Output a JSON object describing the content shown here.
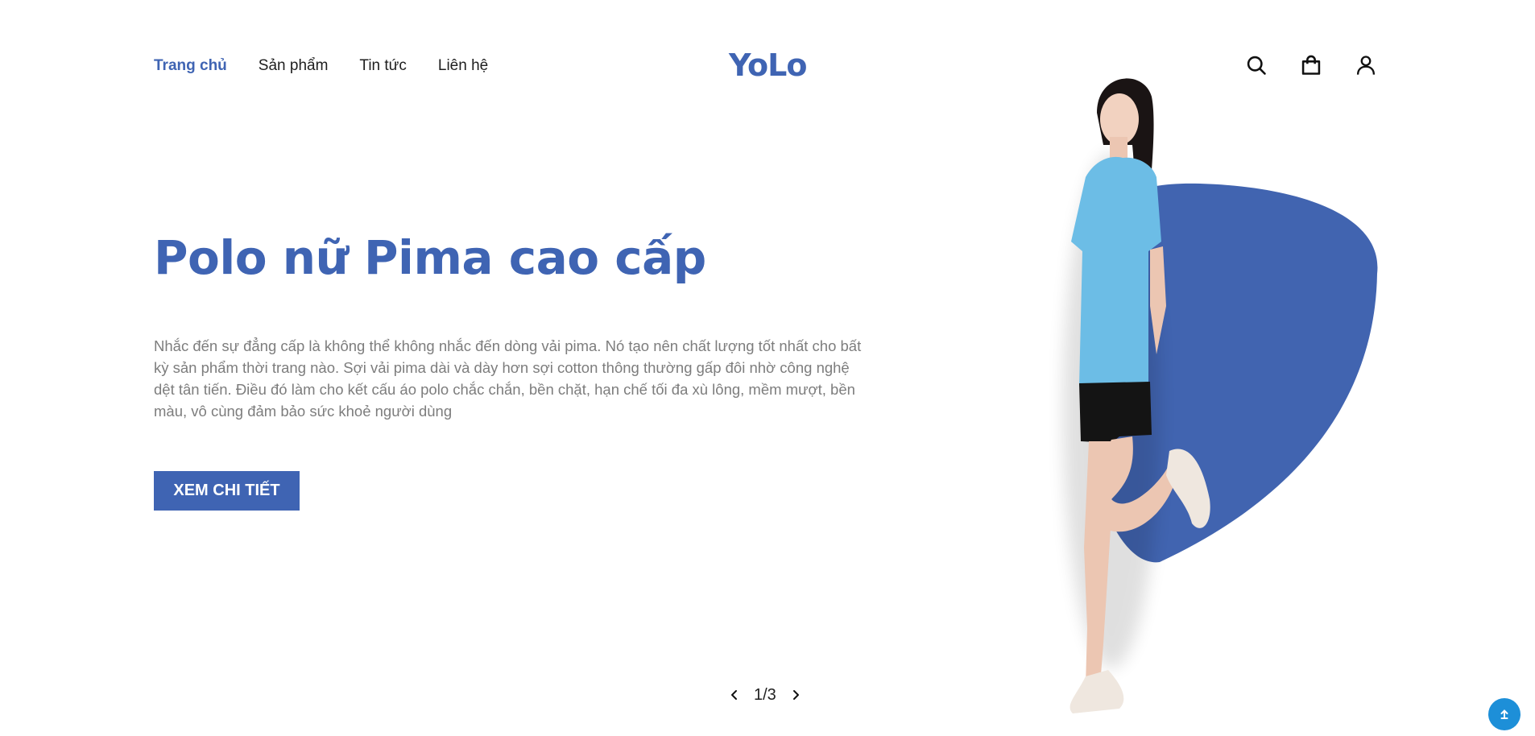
{
  "nav": {
    "items": [
      {
        "label": "Trang chủ",
        "active": true
      },
      {
        "label": "Sản phẩm",
        "active": false
      },
      {
        "label": "Tin tức",
        "active": false
      },
      {
        "label": "Liên hệ",
        "active": false
      }
    ]
  },
  "brand": {
    "logo": "YoLo",
    "accent_color": "#3f64b3"
  },
  "header_icons": [
    "search-icon",
    "shopping-bag-icon",
    "user-icon"
  ],
  "hero": {
    "title": "Polo nữ Pima cao cấp",
    "description": "Nhắc đến sự đẳng cấp là không thể không nhắc đến dòng vải pima. Nó tạo nên chất lượng tốt nhất cho bất kỳ sản phẩm thời trang nào. Sợi vải pima dài và dày hơn sợi cotton thông thường gấp đôi nhờ công nghệ dệt tân tiến. Điều đó làm cho kết cấu áo polo chắc chắn, bền chặt, hạn chế tối đa xù lông, mềm mượt, bền màu, vô cùng đảm bảo sức khoẻ người dùng",
    "cta_label": "XEM CHI TIẾT"
  },
  "slider": {
    "counter": "1/3",
    "prev_icon": "chevron-left-icon",
    "next_icon": "chevron-right-icon"
  },
  "back_to_top": {
    "icon": "arrow-up-icon",
    "color": "#1d8fd8"
  }
}
